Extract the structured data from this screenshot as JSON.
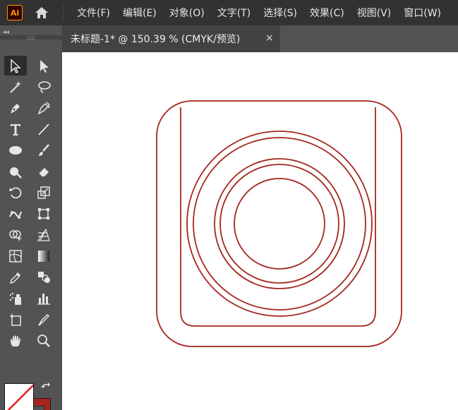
{
  "app": {
    "logo_text": "Ai",
    "menu": [
      "文件(F)",
      "编辑(E)",
      "对象(O)",
      "文字(T)",
      "选择(S)",
      "效果(C)",
      "视图(V)",
      "窗口(W)"
    ]
  },
  "toolbar": {
    "collapse_glyph": "◂◂",
    "tools": [
      "selection-tool",
      "direct-selection-tool",
      "magic-wand-tool",
      "lasso-tool",
      "pen-tool",
      "curvature-tool",
      "type-tool",
      "line-segment-tool",
      "ellipse-tool",
      "paintbrush-tool",
      "shaper-tool",
      "eraser-tool",
      "rotate-tool",
      "scale-tool",
      "puppet-warp-tool",
      "free-transform-tool",
      "shape-builder-tool",
      "perspective-grid-tool",
      "mesh-tool",
      "gradient-tool",
      "eyedropper-tool",
      "blend-tool",
      "symbol-sprayer-tool",
      "column-graph-tool",
      "artboard-tool",
      "slice-tool",
      "hand-tool",
      "zoom-tool"
    ],
    "fill_color": "none",
    "stroke_color": "#a3261e"
  },
  "document": {
    "tab_title": "未标题-1* @ 150.39 % (CMYK/预览)",
    "close_glyph": "×"
  },
  "artwork": {
    "stroke_color": "#a3261e",
    "description_icon": "camera-icon"
  }
}
